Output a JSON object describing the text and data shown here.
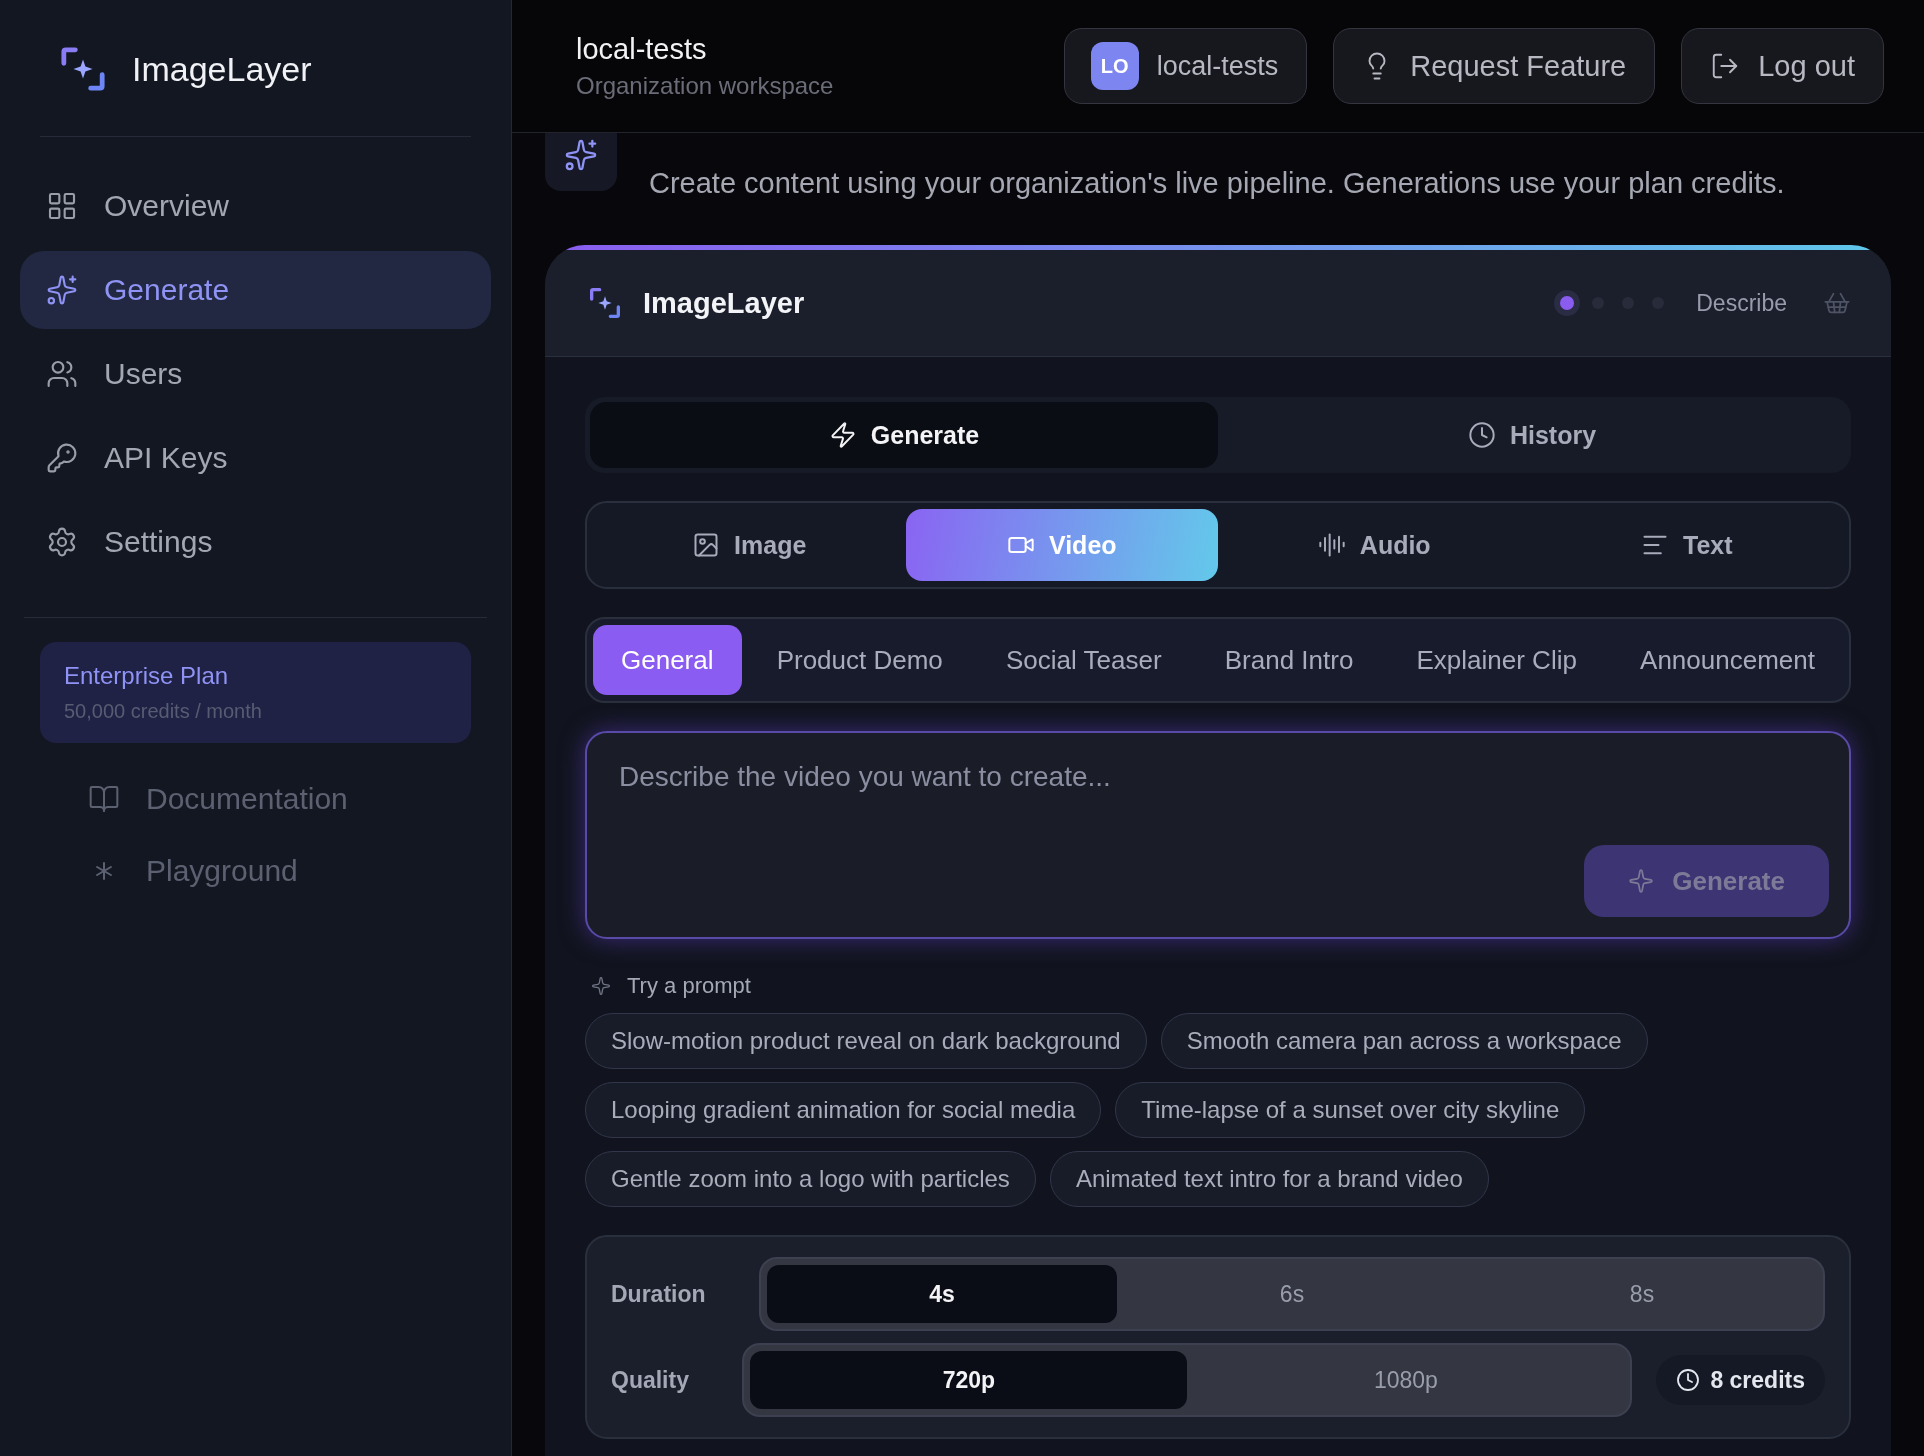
{
  "sidebar": {
    "brand": "ImageLayer",
    "items": [
      {
        "label": "Overview",
        "selected": false
      },
      {
        "label": "Generate",
        "selected": true
      },
      {
        "label": "Users",
        "selected": false
      },
      {
        "label": "API Keys",
        "selected": false
      },
      {
        "label": "Settings",
        "selected": false
      }
    ],
    "plan": {
      "name": "Enterprise Plan",
      "detail": "50,000 credits / month"
    },
    "links": [
      {
        "label": "Documentation"
      },
      {
        "label": "Playground"
      }
    ]
  },
  "header": {
    "org": "local-tests",
    "subtitle": "Organization workspace",
    "account": {
      "initials": "LO",
      "name": "local-tests"
    },
    "buttons": [
      {
        "label": "Request Feature"
      },
      {
        "label": "Log out"
      }
    ]
  },
  "page": {
    "subtitle": "Create content using your organization's live pipeline. Generations use your plan credits."
  },
  "card": {
    "brand": "ImageLayer",
    "step_label": "Describe",
    "steps": [
      {
        "selected": true
      },
      {
        "selected": false
      },
      {
        "selected": false
      },
      {
        "selected": false
      }
    ],
    "mode_tabs": [
      {
        "label": "Generate",
        "selected": true
      },
      {
        "label": "History",
        "selected": false
      }
    ],
    "media_tabs": [
      {
        "label": "Image",
        "selected": false
      },
      {
        "label": "Video",
        "selected": true
      },
      {
        "label": "Audio",
        "selected": false
      },
      {
        "label": "Text",
        "selected": false
      }
    ],
    "presets": [
      {
        "label": "General",
        "selected": true
      },
      {
        "label": "Product Demo",
        "selected": false
      },
      {
        "label": "Social Teaser",
        "selected": false
      },
      {
        "label": "Brand Intro",
        "selected": false
      },
      {
        "label": "Explainer Clip",
        "selected": false
      },
      {
        "label": "Announcement",
        "selected": false
      }
    ],
    "prompt": {
      "placeholder": "Describe the video you want to create..."
    },
    "submit": {
      "label": "Generate",
      "disabled": true
    },
    "suggestions_label": "Try a prompt",
    "suggestions": [
      "Slow-motion product reveal on dark background",
      "Smooth camera pan across a workspace",
      "Looping gradient animation for social media",
      "Time-lapse of a sunset over city skyline",
      "Gentle zoom into a logo with particles",
      "Animated text intro for a brand video"
    ],
    "options": [
      {
        "label": "Duration",
        "choices": [
          {
            "label": "4s",
            "selected": true
          },
          {
            "label": "6s",
            "selected": false
          },
          {
            "label": "8s",
            "selected": false
          }
        ]
      },
      {
        "label": "Quality",
        "choices": [
          {
            "label": "720p",
            "selected": true
          },
          {
            "label": "1080p",
            "selected": false
          }
        ]
      }
    ],
    "cost": "8 credits"
  }
}
